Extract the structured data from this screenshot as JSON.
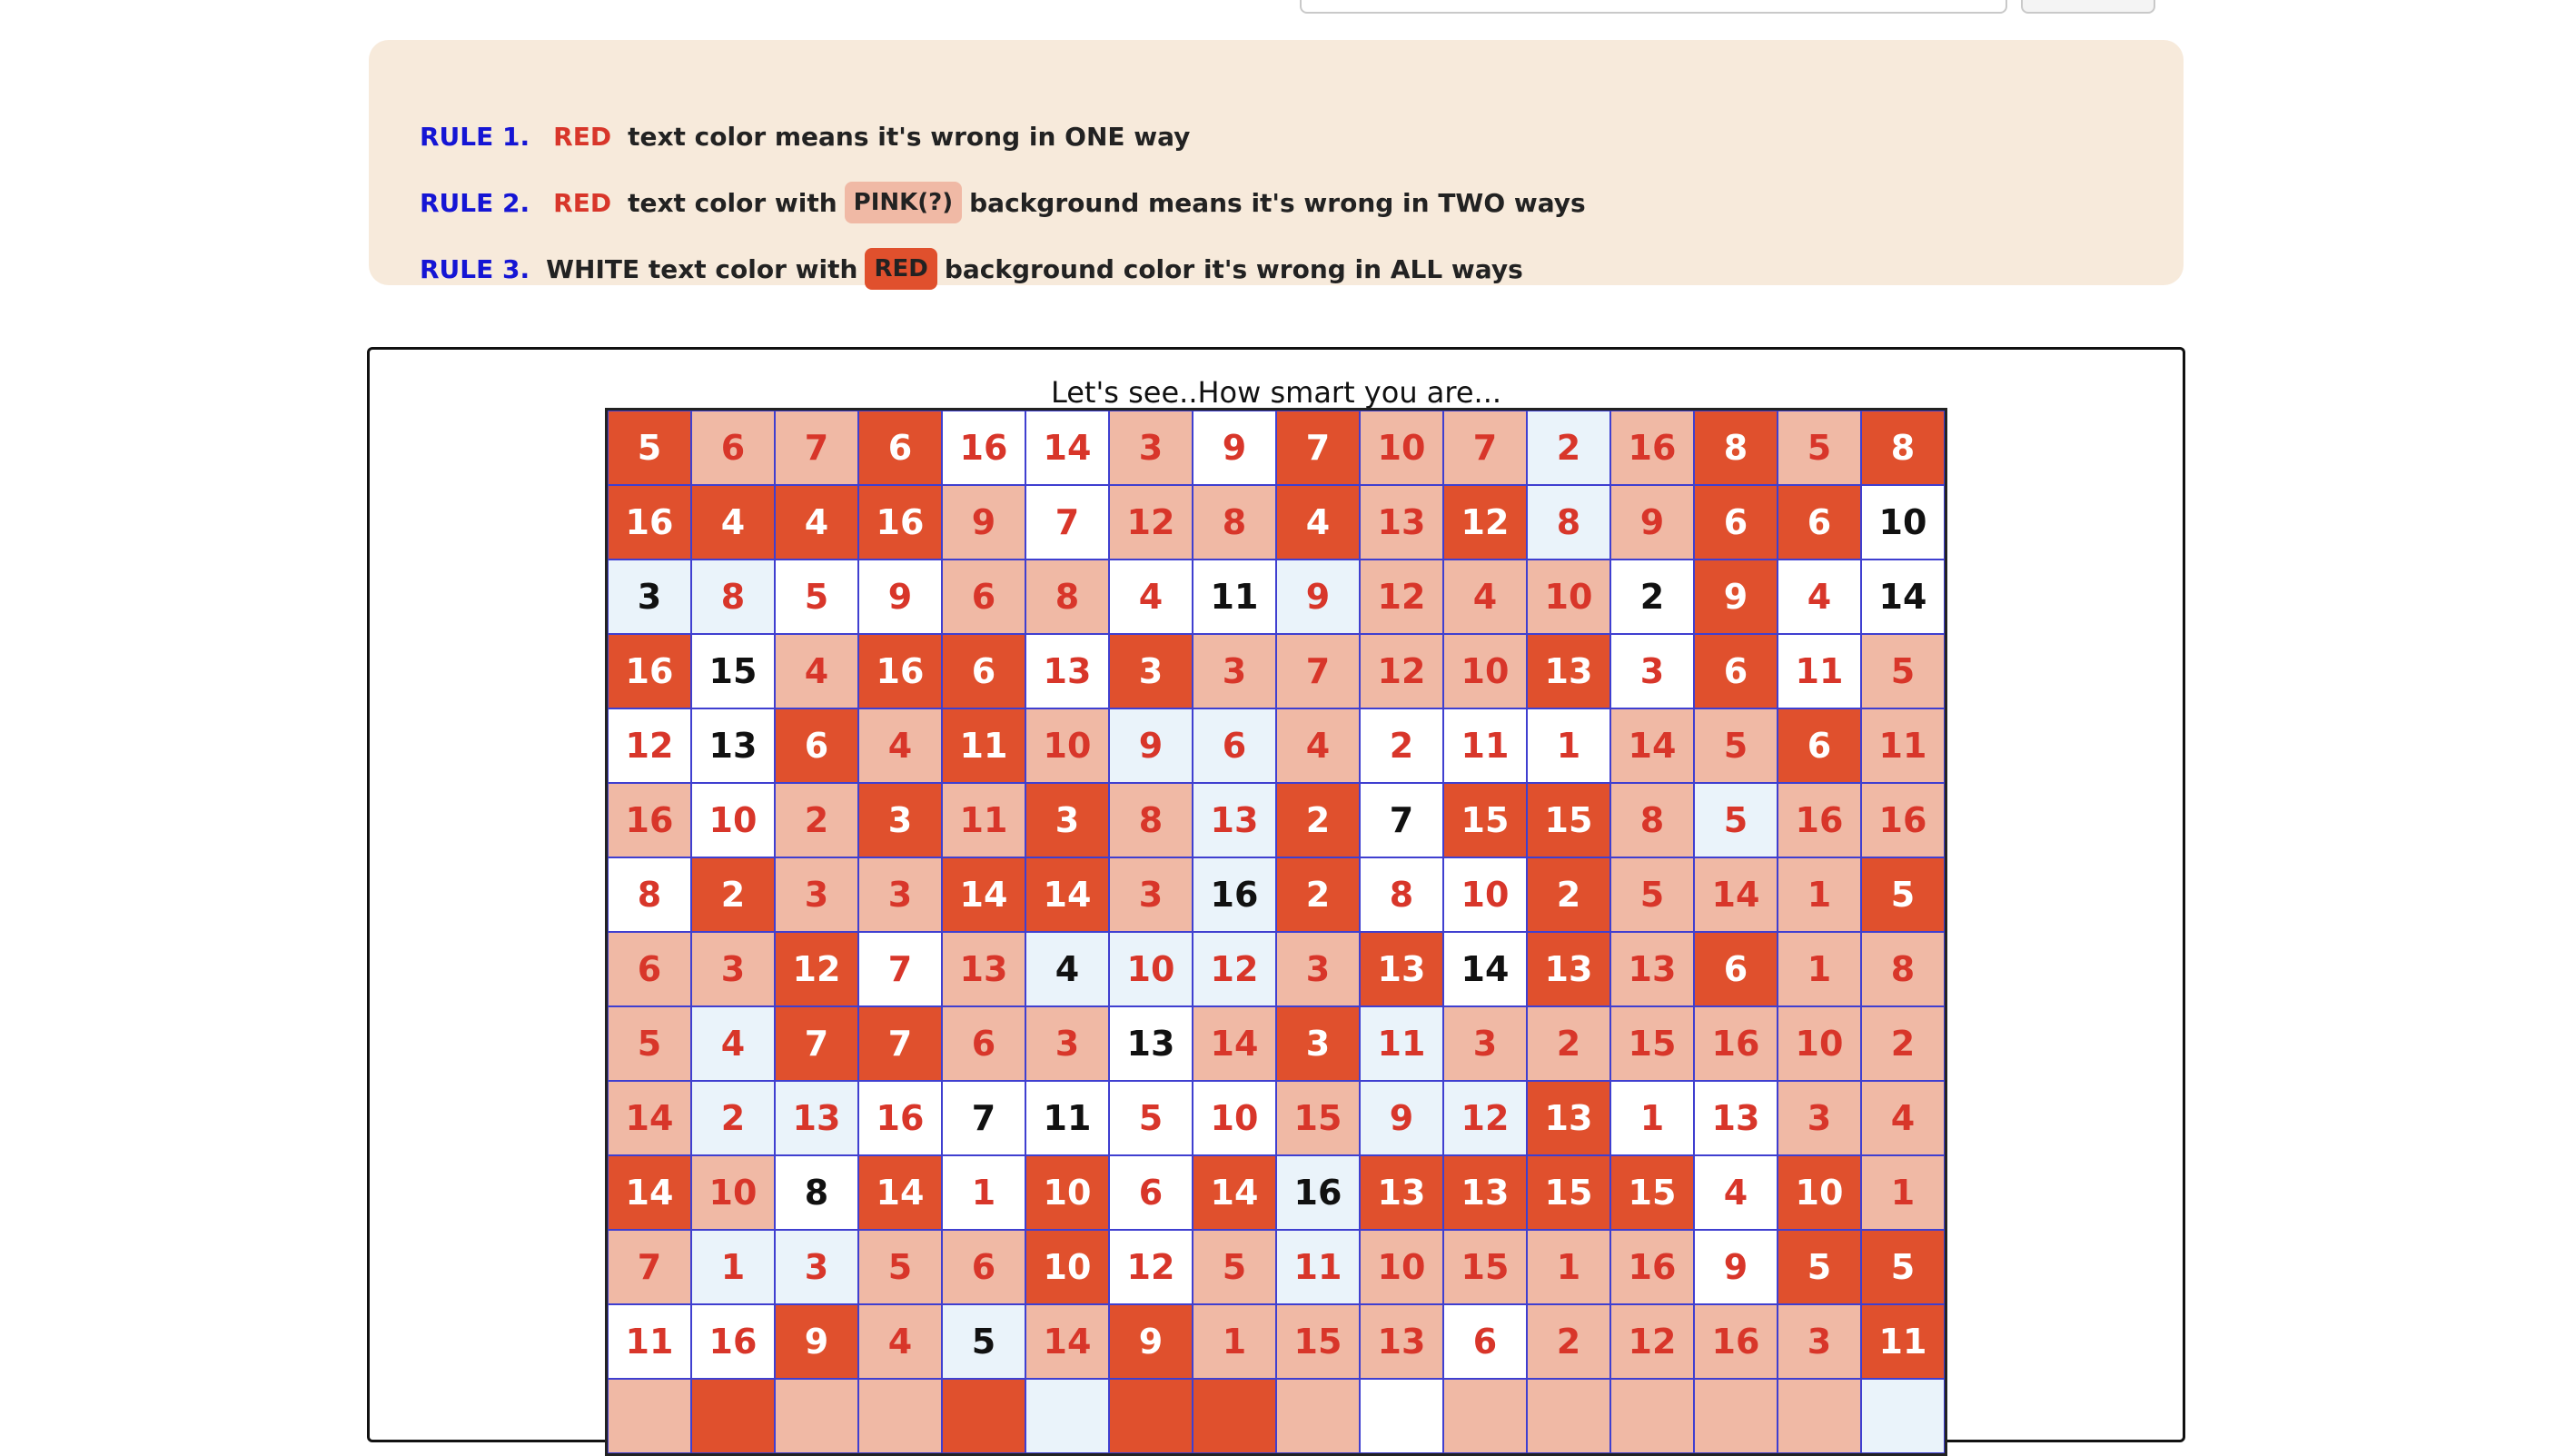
{
  "rules": [
    {
      "num": "RULE 1.",
      "red": "RED",
      "text": "text color means it's wrong in ONE way"
    },
    {
      "num": "RULE 2.",
      "red": "RED",
      "text_before": "text color with",
      "chip": "PINK(?)",
      "text_after": "background means it's wrong in TWO ways"
    },
    {
      "num": "RULE 3.",
      "text_before": "WHITE text color with",
      "chip": "RED",
      "text_after": "background color it's wrong in ALL ways"
    }
  ],
  "game": {
    "title": "Let's see..How smart you are...",
    "colors": {
      "red_bg": "#e0502d",
      "pink_bg": "#f0b9a5",
      "light_blue_bg": "#eaf3fa",
      "red_text": "#d8362a"
    },
    "rows": [
      {
        "values": [
          "5",
          "6",
          "7",
          "6",
          "16",
          "14",
          "3",
          "9",
          "7",
          "10",
          "7",
          "2",
          "16",
          "8",
          "5",
          "8"
        ],
        "states": "RPPRWWPWRPPLPRPR"
      },
      {
        "values": [
          "16",
          "4",
          "4",
          "16",
          "9",
          "7",
          "12",
          "8",
          "4",
          "13",
          "12",
          "8",
          "9",
          "6",
          "6",
          "10"
        ],
        "states": "RRRRPWPPRPRLPRRK"
      },
      {
        "values": [
          "3",
          "8",
          "5",
          "9",
          "6",
          "8",
          "4",
          "11",
          "9",
          "12",
          "4",
          "10",
          "2",
          "9",
          "4",
          "14"
        ],
        "states": "BLWWPPWKLPPPKRWK"
      },
      {
        "values": [
          "16",
          "15",
          "4",
          "16",
          "6",
          "13",
          "3",
          "3",
          "7",
          "12",
          "10",
          "13",
          "3",
          "6",
          "11",
          "5"
        ],
        "states": "RKPRRWRPPPPRWRWP"
      },
      {
        "values": [
          "12",
          "13",
          "6",
          "4",
          "11",
          "10",
          "9",
          "6",
          "4",
          "2",
          "11",
          "1",
          "14",
          "5",
          "6",
          "11"
        ],
        "states": "WKRPRPLLPWWWPPRP"
      },
      {
        "values": [
          "16",
          "10",
          "2",
          "3",
          "11",
          "3",
          "8",
          "13",
          "2",
          "7",
          "15",
          "15",
          "8",
          "5",
          "16",
          "16"
        ],
        "states": "PWPRPRPLRKRRPLPP"
      },
      {
        "values": [
          "8",
          "2",
          "3",
          "3",
          "14",
          "14",
          "3",
          "16",
          "2",
          "8",
          "10",
          "2",
          "5",
          "14",
          "1",
          "5"
        ],
        "states": "WRPPRRPBRWWRPPPR"
      },
      {
        "values": [
          "6",
          "3",
          "12",
          "7",
          "13",
          "4",
          "10",
          "12",
          "3",
          "13",
          "14",
          "13",
          "13",
          "6",
          "1",
          "8"
        ],
        "states": "PPRWPBLLPRKRPRPP"
      },
      {
        "values": [
          "5",
          "4",
          "7",
          "7",
          "6",
          "3",
          "13",
          "14",
          "3",
          "11",
          "3",
          "2",
          "15",
          "16",
          "10",
          "2"
        ],
        "states": "PLRRPPKPRLPPPPPP"
      },
      {
        "values": [
          "14",
          "2",
          "13",
          "16",
          "7",
          "11",
          "5",
          "10",
          "15",
          "9",
          "12",
          "13",
          "1",
          "13",
          "3",
          "4"
        ],
        "states": "PLLWKKWWPLLRWWPP"
      },
      {
        "values": [
          "14",
          "10",
          "8",
          "14",
          "1",
          "10",
          "6",
          "14",
          "16",
          "13",
          "13",
          "15",
          "15",
          "4",
          "10",
          "1"
        ],
        "states": "RPKRWRWRBRRRRWRP"
      },
      {
        "values": [
          "7",
          "1",
          "3",
          "5",
          "6",
          "10",
          "12",
          "5",
          "11",
          "10",
          "15",
          "1",
          "16",
          "9",
          "5",
          "5"
        ],
        "states": "PLLPPRWPLPPPPWRR"
      },
      {
        "values": [
          "11",
          "16",
          "9",
          "4",
          "5",
          "14",
          "9",
          "1",
          "15",
          "13",
          "6",
          "2",
          "12",
          "16",
          "3",
          "11"
        ],
        "states": "WWRPBPRPPPWPPPPR"
      },
      {
        "values": [
          "",
          "",
          "",
          "",
          "",
          "",
          "",
          "",
          "",
          "",
          "",
          "",
          "",
          "",
          "",
          ""
        ],
        "states": "PRPPRLRRPWPPPPPL"
      }
    ]
  }
}
